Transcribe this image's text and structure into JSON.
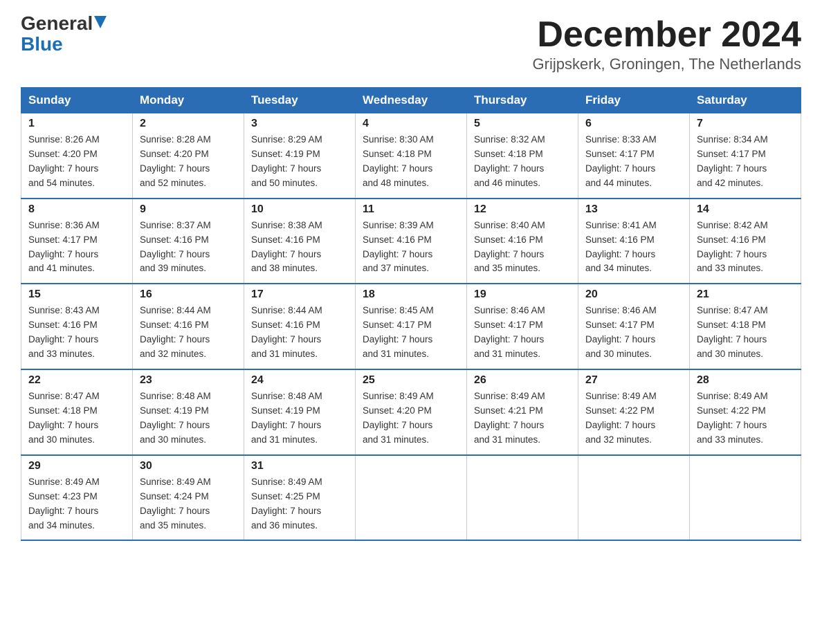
{
  "logo": {
    "general": "General",
    "blue": "Blue",
    "arrow": "▼"
  },
  "header": {
    "month_year": "December 2024",
    "location": "Grijpskerk, Groningen, The Netherlands"
  },
  "days_of_week": [
    "Sunday",
    "Monday",
    "Tuesday",
    "Wednesday",
    "Thursday",
    "Friday",
    "Saturday"
  ],
  "weeks": [
    [
      {
        "day": "1",
        "sunrise": "8:26 AM",
        "sunset": "4:20 PM",
        "daylight": "7 hours and 54 minutes."
      },
      {
        "day": "2",
        "sunrise": "8:28 AM",
        "sunset": "4:20 PM",
        "daylight": "7 hours and 52 minutes."
      },
      {
        "day": "3",
        "sunrise": "8:29 AM",
        "sunset": "4:19 PM",
        "daylight": "7 hours and 50 minutes."
      },
      {
        "day": "4",
        "sunrise": "8:30 AM",
        "sunset": "4:18 PM",
        "daylight": "7 hours and 48 minutes."
      },
      {
        "day": "5",
        "sunrise": "8:32 AM",
        "sunset": "4:18 PM",
        "daylight": "7 hours and 46 minutes."
      },
      {
        "day": "6",
        "sunrise": "8:33 AM",
        "sunset": "4:17 PM",
        "daylight": "7 hours and 44 minutes."
      },
      {
        "day": "7",
        "sunrise": "8:34 AM",
        "sunset": "4:17 PM",
        "daylight": "7 hours and 42 minutes."
      }
    ],
    [
      {
        "day": "8",
        "sunrise": "8:36 AM",
        "sunset": "4:17 PM",
        "daylight": "7 hours and 41 minutes."
      },
      {
        "day": "9",
        "sunrise": "8:37 AM",
        "sunset": "4:16 PM",
        "daylight": "7 hours and 39 minutes."
      },
      {
        "day": "10",
        "sunrise": "8:38 AM",
        "sunset": "4:16 PM",
        "daylight": "7 hours and 38 minutes."
      },
      {
        "day": "11",
        "sunrise": "8:39 AM",
        "sunset": "4:16 PM",
        "daylight": "7 hours and 37 minutes."
      },
      {
        "day": "12",
        "sunrise": "8:40 AM",
        "sunset": "4:16 PM",
        "daylight": "7 hours and 35 minutes."
      },
      {
        "day": "13",
        "sunrise": "8:41 AM",
        "sunset": "4:16 PM",
        "daylight": "7 hours and 34 minutes."
      },
      {
        "day": "14",
        "sunrise": "8:42 AM",
        "sunset": "4:16 PM",
        "daylight": "7 hours and 33 minutes."
      }
    ],
    [
      {
        "day": "15",
        "sunrise": "8:43 AM",
        "sunset": "4:16 PM",
        "daylight": "7 hours and 33 minutes."
      },
      {
        "day": "16",
        "sunrise": "8:44 AM",
        "sunset": "4:16 PM",
        "daylight": "7 hours and 32 minutes."
      },
      {
        "day": "17",
        "sunrise": "8:44 AM",
        "sunset": "4:16 PM",
        "daylight": "7 hours and 31 minutes."
      },
      {
        "day": "18",
        "sunrise": "8:45 AM",
        "sunset": "4:17 PM",
        "daylight": "7 hours and 31 minutes."
      },
      {
        "day": "19",
        "sunrise": "8:46 AM",
        "sunset": "4:17 PM",
        "daylight": "7 hours and 31 minutes."
      },
      {
        "day": "20",
        "sunrise": "8:46 AM",
        "sunset": "4:17 PM",
        "daylight": "7 hours and 30 minutes."
      },
      {
        "day": "21",
        "sunrise": "8:47 AM",
        "sunset": "4:18 PM",
        "daylight": "7 hours and 30 minutes."
      }
    ],
    [
      {
        "day": "22",
        "sunrise": "8:47 AM",
        "sunset": "4:18 PM",
        "daylight": "7 hours and 30 minutes."
      },
      {
        "day": "23",
        "sunrise": "8:48 AM",
        "sunset": "4:19 PM",
        "daylight": "7 hours and 30 minutes."
      },
      {
        "day": "24",
        "sunrise": "8:48 AM",
        "sunset": "4:19 PM",
        "daylight": "7 hours and 31 minutes."
      },
      {
        "day": "25",
        "sunrise": "8:49 AM",
        "sunset": "4:20 PM",
        "daylight": "7 hours and 31 minutes."
      },
      {
        "day": "26",
        "sunrise": "8:49 AM",
        "sunset": "4:21 PM",
        "daylight": "7 hours and 31 minutes."
      },
      {
        "day": "27",
        "sunrise": "8:49 AM",
        "sunset": "4:22 PM",
        "daylight": "7 hours and 32 minutes."
      },
      {
        "day": "28",
        "sunrise": "8:49 AM",
        "sunset": "4:22 PM",
        "daylight": "7 hours and 33 minutes."
      }
    ],
    [
      {
        "day": "29",
        "sunrise": "8:49 AM",
        "sunset": "4:23 PM",
        "daylight": "7 hours and 34 minutes."
      },
      {
        "day": "30",
        "sunrise": "8:49 AM",
        "sunset": "4:24 PM",
        "daylight": "7 hours and 35 minutes."
      },
      {
        "day": "31",
        "sunrise": "8:49 AM",
        "sunset": "4:25 PM",
        "daylight": "7 hours and 36 minutes."
      },
      null,
      null,
      null,
      null
    ]
  ],
  "labels": {
    "sunrise": "Sunrise:",
    "sunset": "Sunset:",
    "daylight": "Daylight:"
  }
}
